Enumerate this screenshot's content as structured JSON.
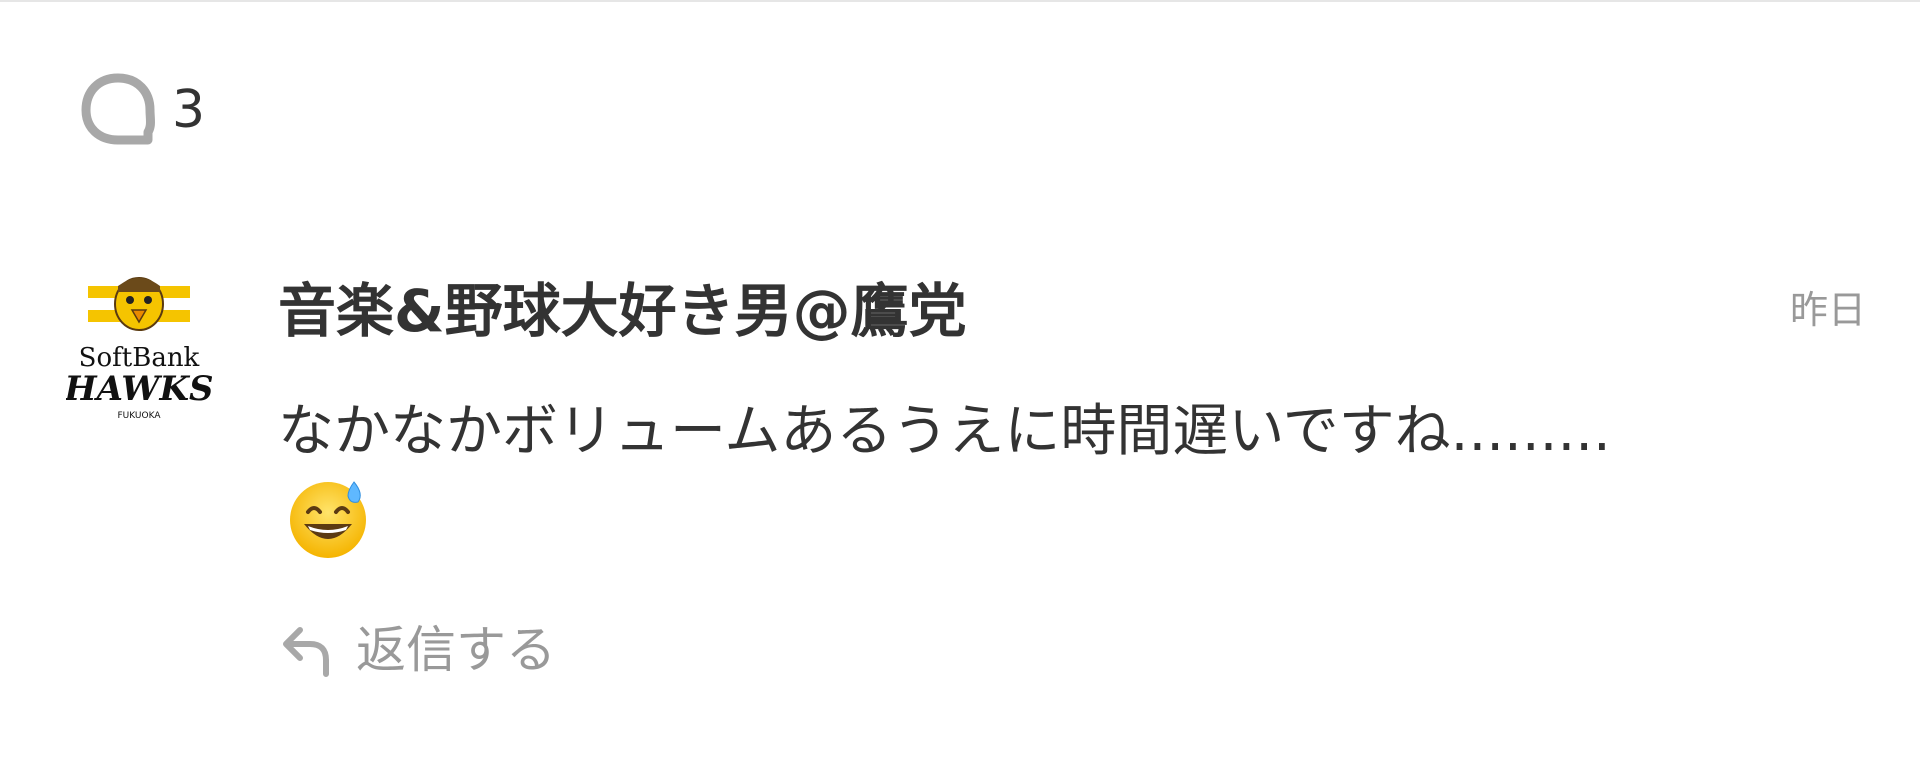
{
  "comments_header": {
    "icon": "comment-bubble-icon",
    "count": "3"
  },
  "comment": {
    "author": "音楽&野球大好き男@鷹党",
    "time": "昨日",
    "text": "なかなかボリュームあるうえに時間遅いですね.........",
    "emoji": "grinning-face-with-sweat-emoji",
    "avatar_text": {
      "line1": "SoftBank",
      "line2": "HAWKS",
      "line3": "FUKUOKA"
    },
    "reply_icon": "reply-arrow-icon",
    "reply_label": "返信する"
  },
  "colors": {
    "text": "#333333",
    "muted": "#999999",
    "icon": "#a8a8a8",
    "hawks_yellow": "#f5c400",
    "divider": "#e6e6e6"
  }
}
